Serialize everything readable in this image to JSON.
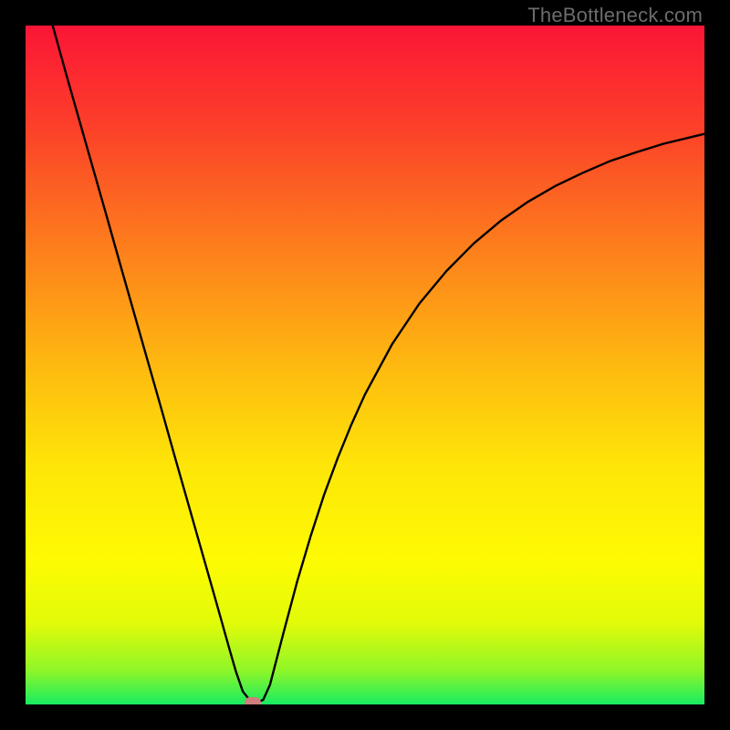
{
  "attribution_label": "TheBottleneck.com",
  "colors": {
    "frame_bg": "#000000",
    "curve_stroke": "#000000",
    "marker_fill": "#cf7f7d",
    "gradient_stops": [
      "#fb1536",
      "#fc4029",
      "#fd7f1c",
      "#feb910",
      "#fee608",
      "#fdfb03",
      "#e2fb09",
      "#8ff628",
      "#17ec62"
    ]
  },
  "chart_data": {
    "type": "line",
    "title": "",
    "xlabel": "",
    "ylabel": "",
    "xlim": [
      0,
      1
    ],
    "ylim": [
      0,
      1.04
    ],
    "grid": false,
    "series": [
      {
        "name": "curve",
        "x": [
          0.04,
          0.06,
          0.08,
          0.1,
          0.12,
          0.14,
          0.16,
          0.18,
          0.2,
          0.22,
          0.24,
          0.26,
          0.28,
          0.3,
          0.31,
          0.32,
          0.33,
          0.34,
          0.35,
          0.36,
          0.38,
          0.4,
          0.42,
          0.44,
          0.46,
          0.48,
          0.5,
          0.54,
          0.58,
          0.62,
          0.66,
          0.7,
          0.74,
          0.78,
          0.82,
          0.86,
          0.9,
          0.94,
          0.98,
          1.0
        ],
        "y": [
          1.04,
          0.965,
          0.892,
          0.819,
          0.746,
          0.672,
          0.599,
          0.526,
          0.453,
          0.379,
          0.306,
          0.233,
          0.16,
          0.086,
          0.05,
          0.02,
          0.007,
          0.003,
          0.007,
          0.03,
          0.11,
          0.188,
          0.258,
          0.322,
          0.378,
          0.429,
          0.475,
          0.552,
          0.614,
          0.664,
          0.706,
          0.741,
          0.77,
          0.794,
          0.814,
          0.832,
          0.846,
          0.859,
          0.869,
          0.874
        ]
      }
    ],
    "marker": {
      "x": 0.335,
      "y": 0.003
    }
  }
}
